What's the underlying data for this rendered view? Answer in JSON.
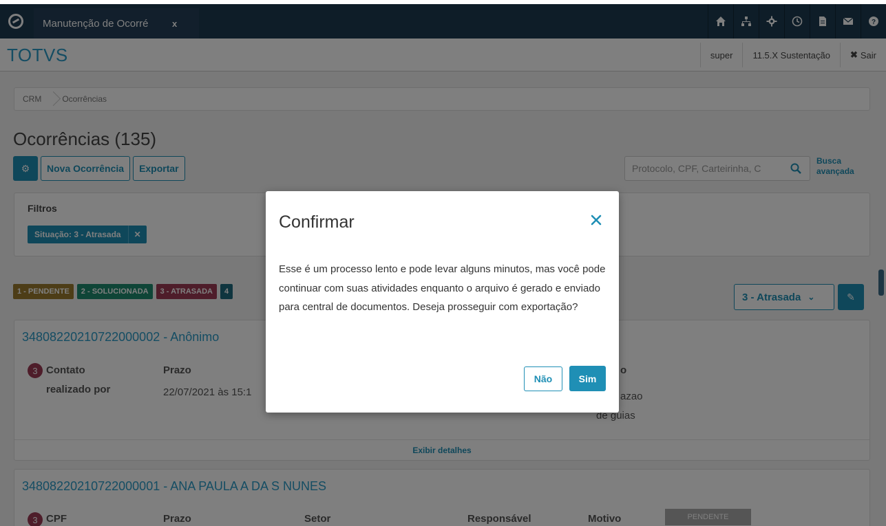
{
  "topbar": {
    "tab_title": "Manutenção de Ocorré",
    "tab_close": "x",
    "icons": [
      "home-icon",
      "sitemap-icon",
      "settings-icon",
      "clock-icon",
      "document-icon",
      "mail-icon",
      "help-icon"
    ]
  },
  "header": {
    "brand": "TOTVS",
    "user": "super",
    "environment": "11.5.X Sustentação",
    "logout": "Sair"
  },
  "breadcrumb": [
    "CRM",
    "Ocorrências"
  ],
  "page": {
    "title": "Ocorrências (135)",
    "new_button": "Nova Ocorrência",
    "export_button": "Exportar",
    "search_placeholder": "Protocolo, CPF, Carteirinha, C",
    "advanced_search": [
      "Busca",
      "avançada"
    ]
  },
  "filters": {
    "title": "Filtros",
    "chip": "Situação: 3 - Atrasada",
    "chip_close": "✕"
  },
  "legend": [
    {
      "label": "1 - PENDENTE",
      "color": "#9a7b2f"
    },
    {
      "label": "2 - SOLUCIONADA",
      "color": "#1e8a6e"
    },
    {
      "label": "3 - ATRASADA",
      "color": "#9c3a54"
    },
    {
      "label": "4",
      "color": "#1e6a7e"
    }
  ],
  "status_select": "3 - Atrasada",
  "cards": [
    {
      "title": "34808220210722000002 - Anônimo",
      "badge": "3",
      "contact_label": "Contato",
      "contact_sub": "realizado por",
      "deadline_label": "Prazo",
      "deadline_value": "22/07/2021 às 15:1",
      "partial_label": "o",
      "partial_value1": "azao",
      "partial_value2": "de guias",
      "footer": "Exibir detalhes"
    },
    {
      "title": "34808220210722000001 - ANA PAULA A DA S NUNES",
      "badge": "3",
      "col1": "CPF",
      "col2": "Prazo",
      "col3": "Setor",
      "col4": "Responsável",
      "col5": "Motivo",
      "status": "PENDENTE"
    }
  ],
  "modal": {
    "title": "Confirmar",
    "body": "Esse é um processo lento e pode levar alguns minutos, mas você pode continuar com suas atividades enquanto o arquivo é gerado e enviado para central de documentos. Deseja prosseguir com exportação?",
    "no_button": "Não",
    "yes_button": "Sim"
  },
  "colors": {
    "topbar": "#1c3b50",
    "accent": "#1f8fb5",
    "brand": "#2a9ac7"
  }
}
